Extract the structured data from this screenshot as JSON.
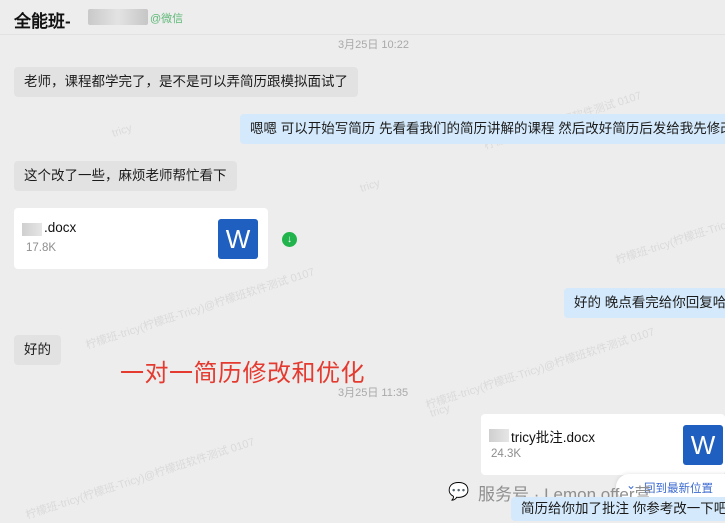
{
  "header": {
    "title": "全能班-",
    "tag": "@微信"
  },
  "timestamps": {
    "top": "3月25日 10:22",
    "middle": "3月25日 11:35"
  },
  "messages": {
    "m1": "老师，课程都学完了，是不是可以弄简历跟模拟面试了",
    "m2": "嗯嗯 可以开始写简历  先看看我们的简历讲解的课程 然后改好简历后发给我先修改哈",
    "m3": "这个改了一些，麻烦老师帮忙看下",
    "m4": "好的  晚点看完给你回复哈",
    "m5": "好的",
    "m6": "简历给你加了批注 你参考改一下吧"
  },
  "files": {
    "file1": {
      "name": ".docx",
      "size": "17.8K",
      "icon": "W"
    },
    "file2": {
      "name": "tricy批注.docx",
      "size": "24.3K",
      "icon": "W"
    }
  },
  "banner": "一对一简历修改和优化",
  "watermarks": {
    "w1": "柠檬班-tricy(柠檬班软件测试 0107",
    "w2": "tricy",
    "w3": "柠檬班-tricy(柠檬班-Tricy)@柠檬班软件测试 0107"
  },
  "jump_button": {
    "label": "回到最新位置",
    "icon": "double-chevron-down-icon"
  },
  "service": {
    "label": "服务号 · Lemon offer营",
    "icon": "wechat-icon"
  },
  "colors": {
    "banner": "#e43a2f",
    "right_bubble": "#d4e9fb",
    "left_bubble": "#e2e2e2",
    "word_icon": "#1e5fbf"
  }
}
